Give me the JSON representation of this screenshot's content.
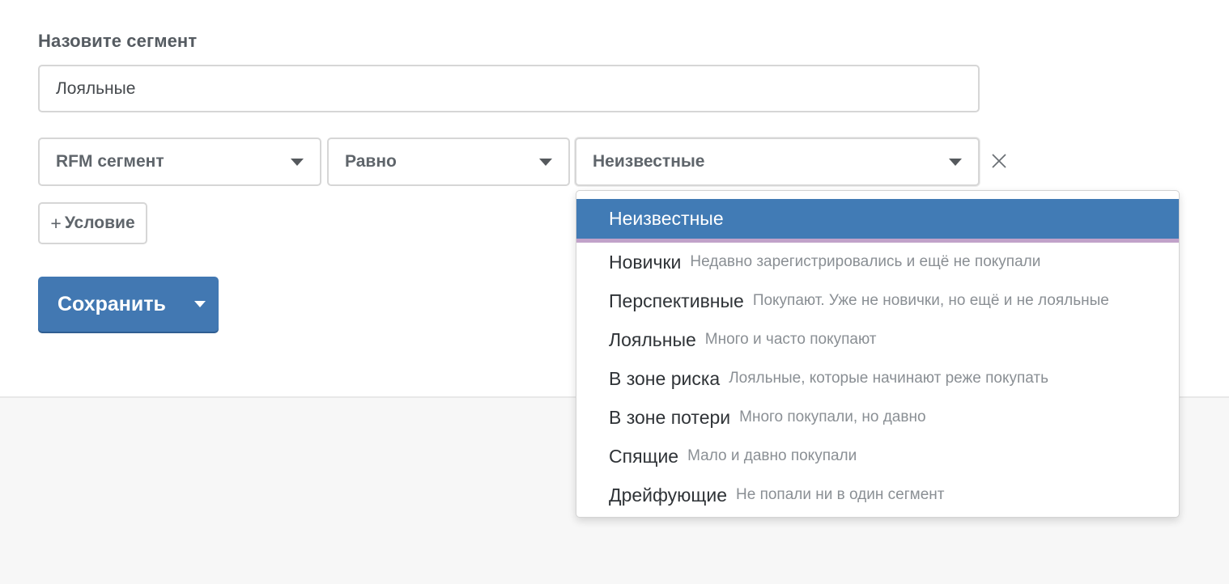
{
  "form": {
    "segment_label": "Назовите сегмент",
    "segment_name_value": "Лояльные"
  },
  "condition": {
    "field": "RFM сегмент",
    "operator": "Равно",
    "value": "Неизвестные"
  },
  "add_condition": {
    "plus": "+",
    "label": "Условие"
  },
  "save_button": {
    "label": "Сохранить"
  },
  "dropdown": {
    "options": [
      {
        "name": "Неизвестные",
        "desc": ""
      },
      {
        "name": "Новички",
        "desc": "Недавно зарегистрировались и ещё не покупали"
      },
      {
        "name": "Перспективные",
        "desc": "Покупают. Уже не новички, но ещё и не лояльные"
      },
      {
        "name": "Лояльные",
        "desc": "Много и часто покупают"
      },
      {
        "name": "В зоне риска",
        "desc": "Лояльные, которые начинают реже покупать"
      },
      {
        "name": "В зоне потери",
        "desc": "Много покупали, но давно"
      },
      {
        "name": "Спящие",
        "desc": "Мало и давно покупали"
      },
      {
        "name": "Дрейфующие",
        "desc": "Не попали ни в один сегмент"
      }
    ]
  },
  "colors": {
    "accent": "#4278b2",
    "highlight": "#417bb5",
    "highlight_underline": "#c1a2c9",
    "footer_background": "#f7f7f7"
  }
}
